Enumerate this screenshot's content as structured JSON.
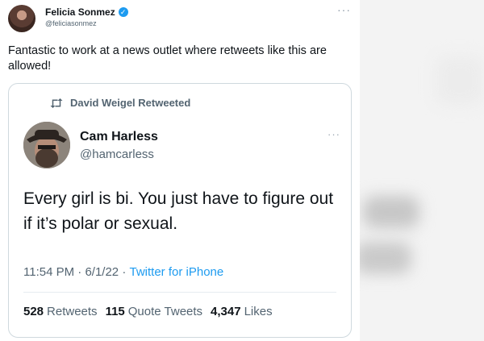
{
  "outer": {
    "name": "Felicia Sonmez",
    "handle": "@feliciasonmez",
    "more": "···",
    "text": "Fantastic to work at a news outlet where retweets like this are allowed!"
  },
  "quoted": {
    "retweeted_by": "David Weigel Retweeted",
    "name": "Cam Harless",
    "handle": "@hamcarless",
    "more": "···",
    "text": "Every girl is bi. You just have to figure out if it’s polar or sexual.",
    "time": "11:54 PM",
    "date": "6/1/22",
    "source": "Twitter for iPhone",
    "sep": " · ",
    "stats": [
      {
        "count": "528",
        "label": "Retweets"
      },
      {
        "count": "115",
        "label": "Quote Tweets"
      },
      {
        "count": "4,347",
        "label": "Likes"
      }
    ]
  },
  "colors": {
    "accent": "#1d9bf0",
    "secondary_text": "#536471",
    "border": "#cfd9de"
  },
  "icons": {
    "verified": "verified-badge-icon",
    "retweet": "retweet-icon",
    "more": "more-options-icon"
  }
}
